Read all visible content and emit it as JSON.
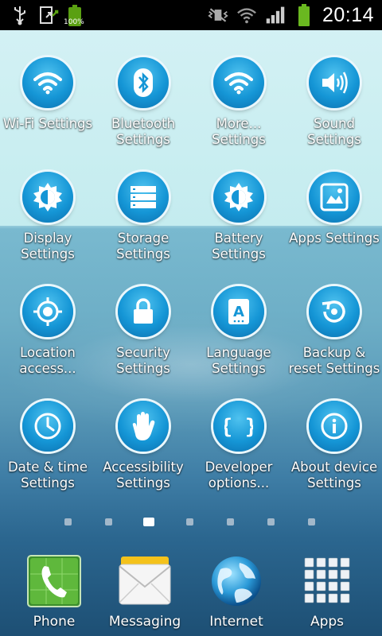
{
  "status_bar": {
    "battery_level_text": "100%",
    "time": "20:14",
    "icons": [
      "usb-icon",
      "download-icon",
      "battery-icon",
      "vibrate-icon",
      "wifi-icon",
      "signal-icon",
      "battery-icon"
    ]
  },
  "grid": {
    "items": [
      {
        "label": "Wi-Fi Settings",
        "icon": "wifi-icon"
      },
      {
        "label": "Bluetooth Settings",
        "icon": "bluetooth-icon"
      },
      {
        "label": "More... Settings",
        "icon": "wifi-icon"
      },
      {
        "label": "Sound Settings",
        "icon": "speaker-icon"
      },
      {
        "label": "Display Settings",
        "icon": "brightness-icon"
      },
      {
        "label": "Storage Settings",
        "icon": "storage-icon"
      },
      {
        "label": "Battery Settings",
        "icon": "brightness-icon"
      },
      {
        "label": "Apps Settings",
        "icon": "apps-icon"
      },
      {
        "label": "Location access...",
        "icon": "location-icon"
      },
      {
        "label": "Security Settings",
        "icon": "lock-icon"
      },
      {
        "label": "Language Settings",
        "icon": "language-icon"
      },
      {
        "label": "Backup & reset Settings",
        "icon": "backup-icon"
      },
      {
        "label": "Date & time Settings",
        "icon": "clock-icon"
      },
      {
        "label": "Accessibility Settings",
        "icon": "hand-icon"
      },
      {
        "label": "Developer options...",
        "icon": "braces-icon"
      },
      {
        "label": "About device Settings",
        "icon": "info-icon"
      }
    ]
  },
  "page_indicator": {
    "count": 7,
    "active_index": 2
  },
  "dock": {
    "items": [
      {
        "label": "Phone",
        "icon": "phone-icon"
      },
      {
        "label": "Messaging",
        "icon": "envelope-icon"
      },
      {
        "label": "Internet",
        "icon": "globe-icon"
      },
      {
        "label": "Apps",
        "icon": "apps-grid-icon"
      }
    ]
  },
  "colors": {
    "accent": "#1596d6",
    "battery": "#5aa012"
  }
}
